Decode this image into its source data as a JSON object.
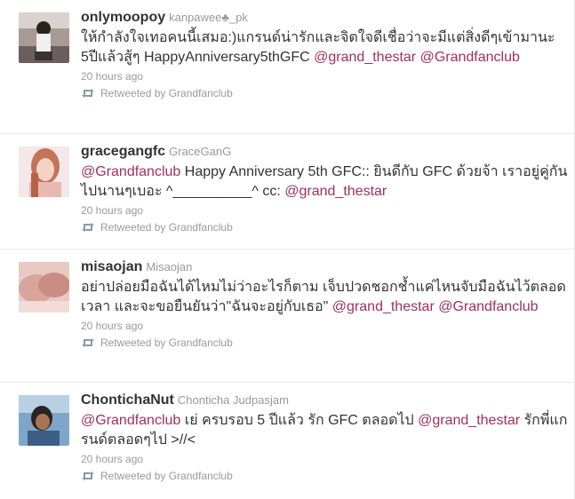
{
  "tweets": [
    {
      "screen_name": "onlymoopoy",
      "full_name": "kanpawee♣_pk",
      "text_parts": [
        "ให้กำลังใจเทอคนนี้เสมอ:)แกรนด์น่ารักและจิตใจดีเชื่อว่าจะมีแต่สิ่งดีๆเข้ามานะ 5ปีแล้วสู้ๆ HappyAnniversary5thGFC "
      ],
      "mentions": [
        "@grand_thestar",
        "@Grandfanclub"
      ],
      "time": "20 hours ago",
      "retweet": "Retweeted by Grandfanclub"
    },
    {
      "screen_name": "gracegangfc",
      "full_name": "GraceGanG",
      "mention_lead": "@Grandfanclub",
      "text": " Happy Anniversary 5th GFC:: ยินดีกับ GFC ด้วยจ้า เราอยู่คู่กันไปนานๆเบอะ ^__________^ cc: ",
      "mention_tail": "@grand_thestar",
      "time": "20 hours ago",
      "retweet": "Retweeted by Grandfanclub"
    },
    {
      "screen_name": "misaojan",
      "full_name": "Misaojan",
      "text": "อย่าปล่อยมือฉันได้ไหมไม่ว่าอะไรก็ตาม เจ็บปวดชอกช้ำแค่ไหนจับมือฉันไว้ตลอดเวลา และจะขอยืนยันว่า\"ฉันจะอยู่กับเธอ\" ",
      "mentions": [
        "@grand_thestar",
        "@Grandfanclub"
      ],
      "time": "20 hours ago",
      "retweet": "Retweeted by Grandfanclub"
    },
    {
      "screen_name": "ChontichaNut",
      "full_name": "Chonticha Judpasjam",
      "mention_lead": "@Grandfanclub",
      "text_mid": " เย่ ครบรอบ 5 ปีแล้ว รัก GFC ตลอดไป ",
      "mention_mid": "@grand_thestar",
      "text_end": " รักพี่แกรนด์ตลอดๆไป >//<",
      "time": "20 hours ago",
      "retweet": "Retweeted by Grandfanclub"
    }
  ],
  "colors": {
    "mention": "#a0305a",
    "meta": "#999999",
    "text": "#333333",
    "divider": "#e8e8e8"
  },
  "icons": {
    "retweet": "retweet-icon"
  }
}
